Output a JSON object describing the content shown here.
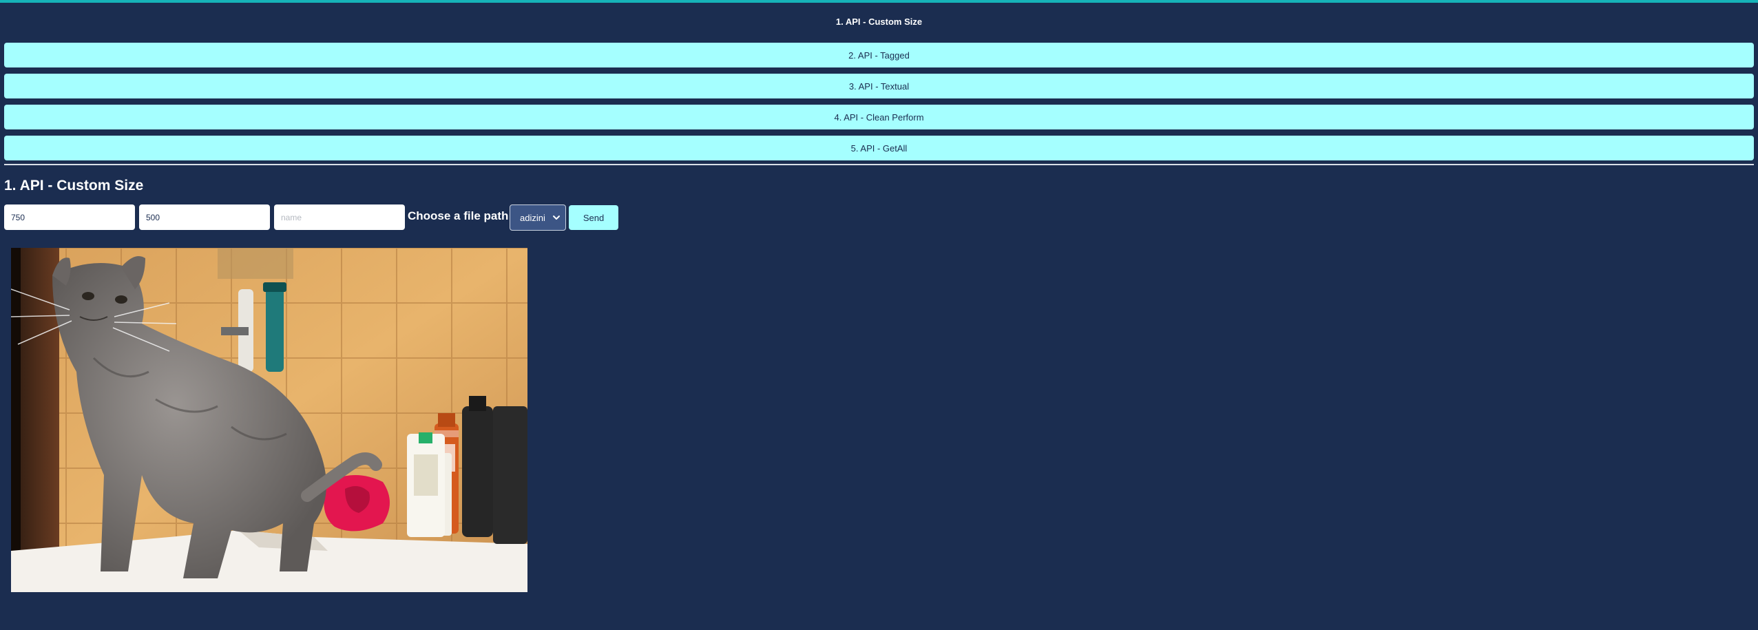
{
  "tabs": [
    {
      "label": "1. API - Custom Size",
      "active": true
    },
    {
      "label": "2. API - Tagged",
      "active": false
    },
    {
      "label": "3. API - Textual",
      "active": false
    },
    {
      "label": "4. API - Clean Perform",
      "active": false
    },
    {
      "label": "5. API - GetAll",
      "active": false
    }
  ],
  "section": {
    "title": "1. API - Custom Size"
  },
  "form": {
    "width_value": "750",
    "height_value": "500",
    "name_placeholder": "name",
    "path_label": "Choose a file path:",
    "path_selected": "adizini",
    "send_label": "Send"
  },
  "result_image": {
    "subject": "cat-on-bathroom-sink"
  },
  "colors": {
    "background": "#1b2d50",
    "accent_button": "#a5ffff",
    "top_border": "#16b3b8",
    "select_bg": "#3c5585"
  }
}
